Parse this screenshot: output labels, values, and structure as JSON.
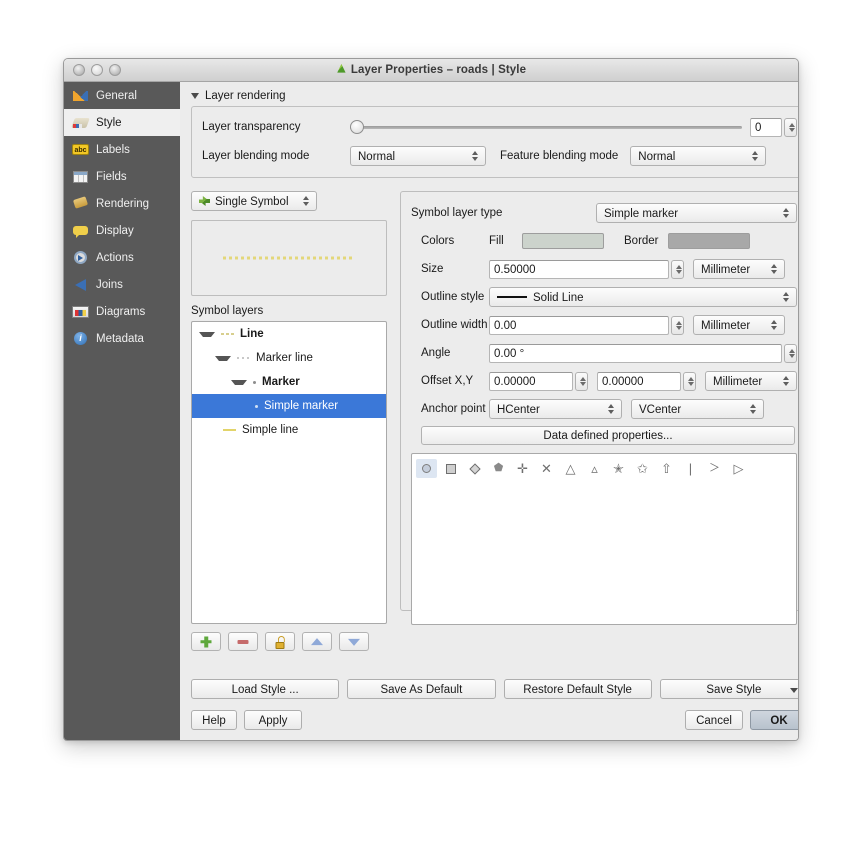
{
  "window": {
    "title": "Layer Properties – roads | Style",
    "title_icon": "qgis-layer-icon",
    "traffic_lights": [
      "close",
      "minimize",
      "maximize"
    ]
  },
  "sidebar": {
    "items": [
      {
        "label": "General",
        "icon": "hammer-wrench-icon",
        "active": false
      },
      {
        "label": "Style",
        "icon": "paintbrush-icon",
        "active": true
      },
      {
        "label": "Labels",
        "icon": "abc-label-icon",
        "active": false
      },
      {
        "label": "Fields",
        "icon": "table-grid-icon",
        "active": false
      },
      {
        "label": "Rendering",
        "icon": "broom-icon",
        "active": false
      },
      {
        "label": "Display",
        "icon": "speech-bubble-icon",
        "active": false
      },
      {
        "label": "Actions",
        "icon": "gear-play-icon",
        "active": false
      },
      {
        "label": "Joins",
        "icon": "join-arrow-icon",
        "active": false
      },
      {
        "label": "Diagrams",
        "icon": "bar-chart-icon",
        "active": false
      },
      {
        "label": "Metadata",
        "icon": "info-circle-icon",
        "active": false
      }
    ]
  },
  "layer_rendering": {
    "section_title": "Layer rendering",
    "transparency_label": "Layer transparency",
    "transparency_value": "0",
    "blending_label": "Layer blending mode",
    "blending_value": "Normal",
    "feature_blending_label": "Feature blending mode",
    "feature_blending_value": "Normal"
  },
  "symbol": {
    "renderer": "Single Symbol",
    "renderer_icon": "single-symbol-icon",
    "preview_icon": "dashed-yellow-line-preview",
    "symbol_layers_label": "Symbol layers",
    "tree": [
      {
        "label": "Line",
        "indent": 0,
        "expanded": true,
        "bold": true,
        "selected": false,
        "swatch": "dashed-line-swatch"
      },
      {
        "label": "Marker line",
        "indent": 1,
        "expanded": true,
        "bold": false,
        "selected": false,
        "swatch": "dotted-line-swatch"
      },
      {
        "label": "Marker",
        "indent": 2,
        "expanded": true,
        "bold": true,
        "selected": false,
        "swatch": "dot-swatch"
      },
      {
        "label": "Simple marker",
        "indent": 3,
        "expanded": false,
        "bold": false,
        "selected": true,
        "swatch": "dot-swatch-white"
      },
      {
        "label": "Simple line",
        "indent": 1,
        "expanded": false,
        "bold": false,
        "selected": false,
        "swatch": "solid-yellow-line-swatch"
      }
    ],
    "toolbar": [
      {
        "name": "add-symbol-layer",
        "icon": "plus-icon"
      },
      {
        "name": "remove-symbol-layer",
        "icon": "minus-icon"
      },
      {
        "name": "lock-symbol-layer",
        "icon": "lock-icon"
      },
      {
        "name": "move-up",
        "icon": "arrow-up-icon"
      },
      {
        "name": "move-down",
        "icon": "arrow-down-icon"
      }
    ]
  },
  "properties": {
    "symbol_layer_type_label": "Symbol layer type",
    "symbol_layer_type_value": "Simple marker",
    "colors_label": "Colors",
    "fill_label": "Fill",
    "fill_color": "#ccd3cc",
    "border_label": "Border",
    "border_color": "#a8a8a8",
    "size_label": "Size",
    "size_value": "0.50000",
    "size_unit": "Millimeter",
    "outline_style_label": "Outline style",
    "outline_style_value": "Solid Line",
    "outline_width_label": "Outline width",
    "outline_width_value": "0.00",
    "outline_width_unit": "Millimeter",
    "angle_label": "Angle",
    "angle_value": "0.00 °",
    "offset_label": "Offset X,Y",
    "offset_x_value": "0.00000",
    "offset_y_value": "0.00000",
    "offset_unit": "Millimeter",
    "anchor_label": "Anchor point",
    "anchor_h_value": "HCenter",
    "anchor_v_value": "VCenter",
    "data_defined_label": "Data defined properties...",
    "shapes": [
      {
        "name": "circle-marker",
        "glyph": "●",
        "selected": true
      },
      {
        "name": "square-marker",
        "glyph": "■",
        "selected": false
      },
      {
        "name": "diamond-marker",
        "glyph": "◆",
        "selected": false
      },
      {
        "name": "pentagon-marker",
        "glyph": "⬟",
        "selected": false
      },
      {
        "name": "cross-marker",
        "glyph": "✛",
        "selected": false
      },
      {
        "name": "x-cross-marker",
        "glyph": "✕",
        "selected": false
      },
      {
        "name": "triangle-marker",
        "glyph": "△",
        "selected": false
      },
      {
        "name": "equilateral-triangle-marker",
        "glyph": "▵",
        "selected": false
      },
      {
        "name": "star-marker",
        "glyph": "✭",
        "selected": false
      },
      {
        "name": "star-outline-marker",
        "glyph": "✩",
        "selected": false
      },
      {
        "name": "arrow-marker",
        "glyph": "⇧",
        "selected": false
      },
      {
        "name": "line-marker",
        "glyph": "|",
        "selected": false
      },
      {
        "name": "arrowhead-marker",
        "glyph": "＞",
        "selected": false
      },
      {
        "name": "filled-arrowhead-marker",
        "glyph": "▷",
        "selected": false
      }
    ]
  },
  "buttons": {
    "load_style": "Load Style ...",
    "save_as_default": "Save As Default",
    "restore_default_style": "Restore Default Style",
    "save_style": "Save Style",
    "help": "Help",
    "apply": "Apply",
    "cancel": "Cancel",
    "ok": "OK"
  }
}
